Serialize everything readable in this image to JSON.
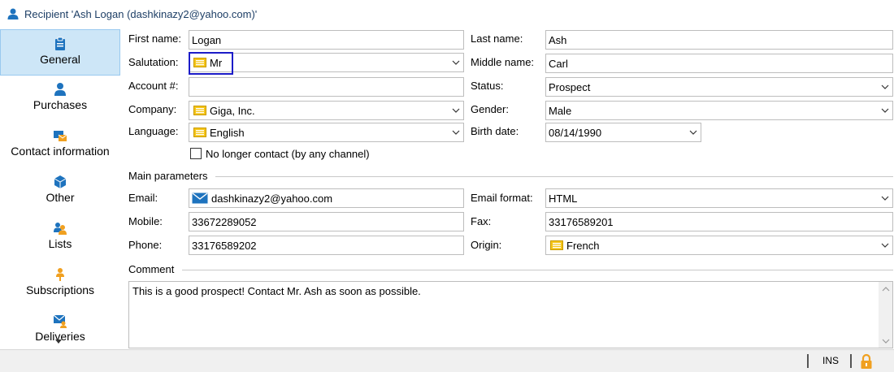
{
  "window": {
    "title": "Recipient 'Ash Logan (dashkinazy2@yahoo.com)'"
  },
  "sidebar": {
    "items": [
      {
        "label": "General",
        "icon": "clipboard-icon",
        "active": true
      },
      {
        "label": "Purchases",
        "icon": "person-icon"
      },
      {
        "label": "Contact information",
        "icon": "contact-card-icon"
      },
      {
        "label": "Other",
        "icon": "cube-icon"
      },
      {
        "label": "Lists",
        "icon": "group-icon"
      },
      {
        "label": "Subscriptions",
        "icon": "subscriber-icon"
      },
      {
        "label": "Deliveries",
        "icon": "envelope-person-icon"
      }
    ]
  },
  "form": {
    "first_name": {
      "label": "First name:",
      "value": "Logan"
    },
    "last_name": {
      "label": "Last name:",
      "value": "Ash"
    },
    "salutation": {
      "label": "Salutation:",
      "value": "Mr"
    },
    "middle_name": {
      "label": "Middle name:",
      "value": "Carl"
    },
    "account": {
      "label": "Account #:",
      "value": ""
    },
    "status": {
      "label": "Status:",
      "value": "Prospect"
    },
    "company": {
      "label": "Company:",
      "value": "Giga, Inc."
    },
    "gender": {
      "label": "Gender:",
      "value": "Male"
    },
    "language": {
      "label": "Language:",
      "value": "English"
    },
    "birth_date": {
      "label": "Birth date:",
      "value": "08/14/1990"
    },
    "no_longer_contact": {
      "label": "No longer contact (by any channel)",
      "checked": false
    }
  },
  "main_parameters": {
    "title": "Main parameters",
    "email": {
      "label": "Email:",
      "value": "dashkinazy2@yahoo.com"
    },
    "email_format": {
      "label": "Email format:",
      "value": "HTML"
    },
    "mobile": {
      "label": "Mobile:",
      "value": "33672289052"
    },
    "fax": {
      "label": "Fax:",
      "value": "33176589201"
    },
    "phone": {
      "label": "Phone:",
      "value": "33176589202"
    },
    "origin": {
      "label": "Origin:",
      "value": "French"
    }
  },
  "comment": {
    "title": "Comment",
    "text": "This is a good prospect! Contact Mr. Ash as soon as possible."
  },
  "statusbar": {
    "mode": "INS",
    "lock_icon": "lock-icon"
  },
  "colors": {
    "accent_blue": "#1e73be",
    "enum_yellow": "#f5c518",
    "selection_bg": "#cde6f7",
    "focus_border": "#1c1cc8",
    "lock_orange": "#f0a020"
  }
}
